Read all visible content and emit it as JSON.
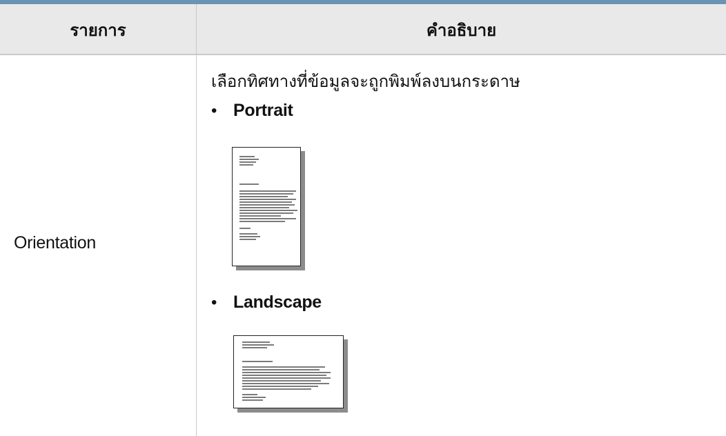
{
  "table": {
    "headers": {
      "item": "รายการ",
      "description": "คำอธิบาย"
    },
    "row": {
      "item": "Orientation",
      "description": "เลือกทิศทางที่ข้อมูลจะถูกพิมพ์ลงบนกระดาษ",
      "options": [
        {
          "label": "Portrait",
          "icon": "portrait-page-icon"
        },
        {
          "label": "Landscape",
          "icon": "landscape-page-icon"
        }
      ]
    }
  },
  "colors": {
    "top_rule": "#6b93b4",
    "header_bg": "#e9e9e9",
    "border": "#c9c9c9"
  }
}
